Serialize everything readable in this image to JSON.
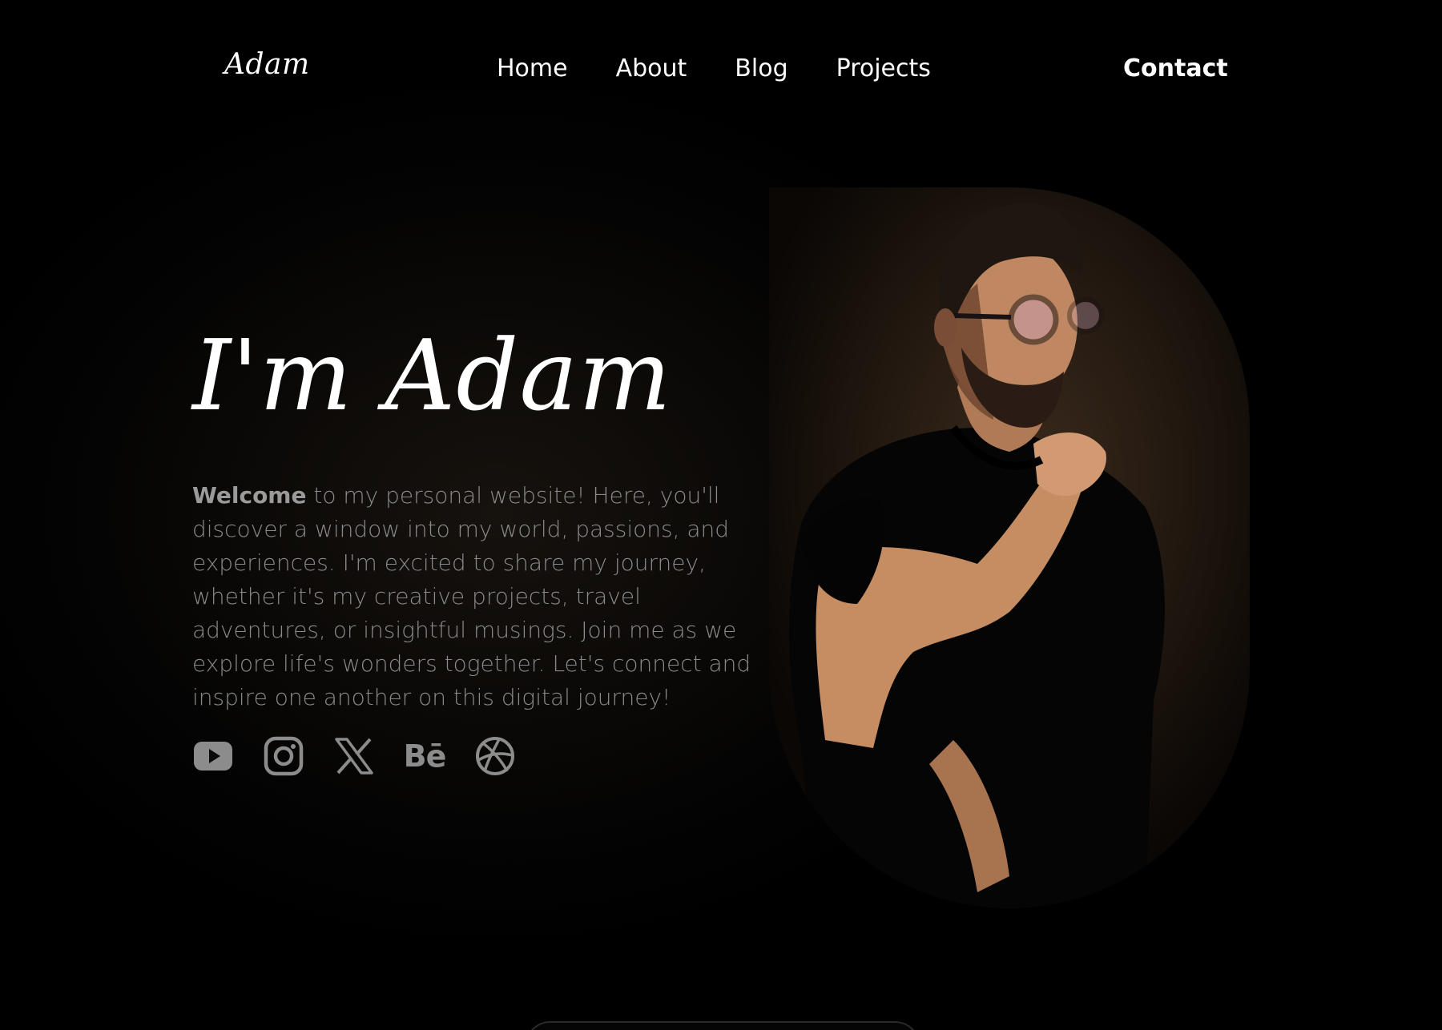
{
  "header": {
    "logo": "Adam",
    "nav": [
      "Home",
      "About",
      "Blog",
      "Projects"
    ],
    "contact": "Contact"
  },
  "hero": {
    "title": "I'm Adam",
    "intro_bold": "Welcome",
    "intro_rest": " to my personal website! Here, you'll discover a window into my world, passions, and experiences. I'm excited to share my journey, whether it's my creative projects, travel adventures, or insightful musings. Join me as we explore life's wonders together. Let's connect and inspire one another on this digital journey!",
    "behance_label": "Bē"
  },
  "socials": [
    "youtube-icon",
    "instagram-icon",
    "x-icon",
    "behance-icon",
    "dribbble-icon"
  ],
  "colors": {
    "background": "#000000",
    "text": "#ffffff",
    "muted_text": "#8a8a8a",
    "portrait_bg": "#2a1e14"
  }
}
